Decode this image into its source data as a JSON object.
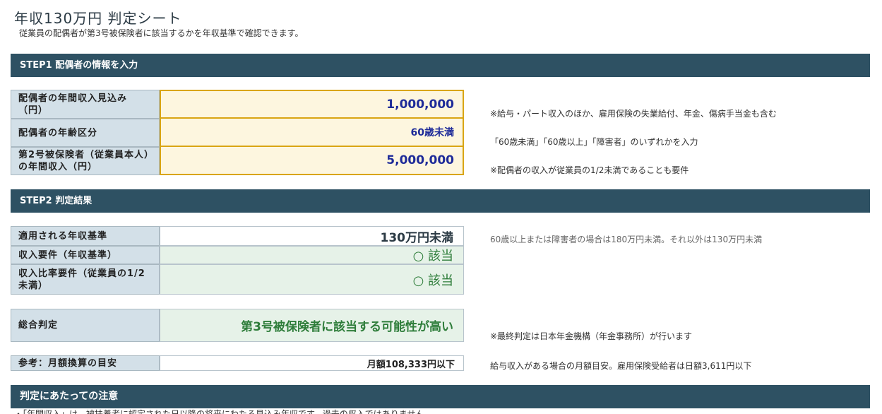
{
  "header": {
    "title": "年収130万円 判定シート",
    "subtitle": "従業員の配偶者が第3号被保険者に該当するかを年収基準で確認できます。"
  },
  "step1": {
    "heading": "STEP1 配偶者の情報を入力",
    "rows": [
      {
        "label": "配偶者の年間収入見込み（円）",
        "value": "1,000,000",
        "note": "※給与・パート収入のほか、雇用保険の失業給付、年金、傷病手当金も含む"
      },
      {
        "label": "配偶者の年齢区分",
        "value": "60歳未満",
        "note": "「60歳未満」「60歳以上」「障害者」のいずれかを入力"
      },
      {
        "label": "第2号被保険者（従業員本人）の年間収入（円）",
        "value": "5,000,000",
        "note": "※配偶者の収入が従業員の1/2未満であることも要件"
      }
    ]
  },
  "step2": {
    "heading": "STEP2 判定結果",
    "rows": [
      {
        "label": "適用される年収基準",
        "value": "130万円未満",
        "note": "60歳以上または障害者の場合は180万円未満。それ以外は130万円未満"
      },
      {
        "label": "収入要件（年収基準）",
        "value": "○ 該当"
      },
      {
        "label": "収入比率要件（従業員の1/2未満）",
        "value": "○ 該当"
      }
    ],
    "overall": {
      "label": "総合判定",
      "value": "第3号被保険者に該当する可能性が高い",
      "note": "※最終判定は日本年金機構（年金事務所）が行います"
    },
    "reference": {
      "label": "参考：月額換算の目安",
      "value": "月額108,333円以下",
      "note": "給与収入がある場合の月額目安。雇用保険受給者は日額3,611円以下"
    }
  },
  "caution": {
    "heading": "判定にあたっての注意",
    "first_line": "・「年間収入」は、被扶養者に認定された日以降の将来にわたる見込み年収です。過去の収入ではありません"
  },
  "colors": {
    "bar": "#2e5163",
    "label_bg": "#d3e0e8",
    "input_bg": "#fdf6df",
    "input_border": "#d9a514",
    "result_green_bg": "#e6f2e8",
    "ok_green": "#2e7d3a",
    "input_text": "#1e2b99"
  }
}
